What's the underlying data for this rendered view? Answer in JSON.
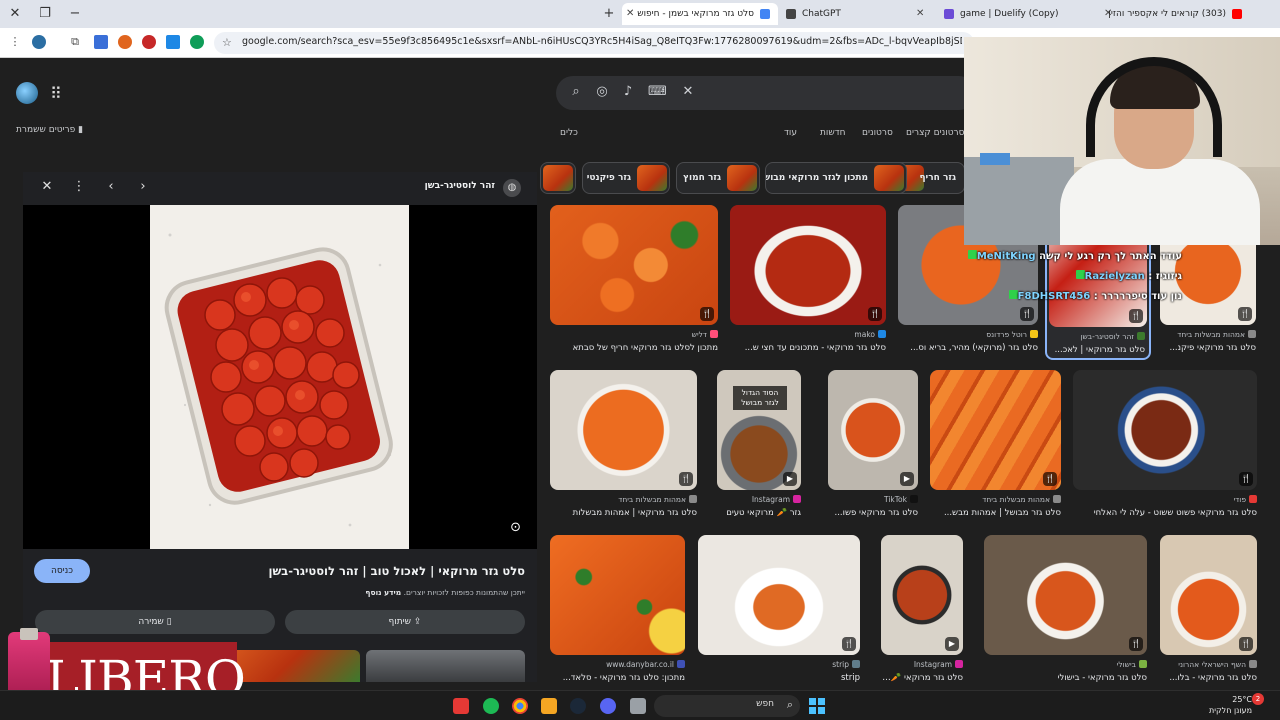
{
  "browser": {
    "tabs": [
      {
        "label": "סלט גזר מרוקאי בשמן - חיפוש",
        "active": true,
        "icon_color": "#4285f4"
      },
      {
        "label": "ChatGPT",
        "active": false,
        "icon_color": "#444444"
      },
      {
        "label": "game | Duelify (Copy)",
        "active": false,
        "icon_color": "#6b4bd6"
      },
      {
        "label": "(303) קוראים לי אקספיר והזין",
        "active": false,
        "icon_color": "#ff0000"
      }
    ],
    "new_tab": "+",
    "url": "google.com/search?sca_esv=55e9f3c856495c1e&sxsrf=ANbL-n6iHUsCQ3YRc5H4iSag_Q8eITQ3Fw:1776280097619&udm=2&fbs=ADc_l-bqvVeapIb8jSDlmbeWzvbR33r0bwiw_b"
  },
  "google": {
    "saved_label": "פריטים ששמרת",
    "search_value": "",
    "filters": [
      "סרטונים קצרים",
      "סרטונים",
      "חדשות",
      "עוד",
      "כלים"
    ],
    "chips": [
      {
        "label": "גזר חריף"
      },
      {
        "label": "מתכון לגזר מרוקאי מבושל"
      },
      {
        "label": "גזר חמוץ"
      },
      {
        "label": "גזר פיקנטי"
      }
    ]
  },
  "preview": {
    "source": "זהר לוסטיגר-בשן",
    "title": "סלט גזר מרוקאי | לאכול טוב | זהר לוסטיגר-בשן",
    "note_prefix": "ייתכן שהתמונות כפופות לזכויות יוצרים.",
    "note_link": "מידע נוסף",
    "visit_label": "כניסה",
    "share_label": "שיתוף",
    "save_label": "שמירה"
  },
  "results": [
    {
      "source": "דליש",
      "title": "מתכון לסלט גזר מרוקאי חריף של סבתא",
      "badge": "🍴",
      "src_color": "#ff4f7a"
    },
    {
      "source": "mako",
      "title": "סלט גזר מרוקאי - מתכונים עד חצי ש...",
      "badge": "🍴",
      "src_color": "#1e88e5"
    },
    {
      "source": "רוטל פרדונס",
      "title": "סלט גזר (מרוקאי) מהיר, בריא וס...",
      "badge": "🍴",
      "src_color": "#f5c518"
    },
    {
      "source": "זהר לוסטיגר-בשן",
      "title": "סלט גזר מרוקאי | לאכ...",
      "badge": "🍴",
      "src_color": "#3c7a2d"
    },
    {
      "source": "אמהות מבשלות ביחד",
      "title": "סלט גזר מרוקאי פיקנ...",
      "badge": "🍴",
      "src_color": "#8a8a8a"
    },
    {
      "source": "פודי",
      "title": "סלט גזר מרוקאי פשוט ששוט - עלה לי האלחי",
      "badge": "🍴",
      "src_color": "#e53935"
    },
    {
      "source": "אמהות מבשלות ביחד",
      "title": "סלט גזר מבושל | אמהות מבש...",
      "badge": "🍴",
      "src_color": "#8a8a8a"
    },
    {
      "source": "TikTok",
      "title": "סלט גזר מרוקאי פשו...",
      "badge": "▶",
      "src_color": "#111111"
    },
    {
      "source": "Instagram",
      "title": "גזר 🥕 מרוקאי טעים",
      "badge": "▶",
      "src_color": "#d6249f"
    },
    {
      "source": "אמהות מבשלות ביחד",
      "title": "סלט גזר מרוקאי | אמהות מבשלות",
      "badge": "🍴",
      "src_color": "#8a8a8a"
    },
    {
      "source": "השף הישראלי אהרוני",
      "title": "סלט גזר מרוקאי - בלו...",
      "badge": "🍴",
      "src_color": "#8a8a8a"
    },
    {
      "source": "בישולי",
      "title": "סלט גזר מרוקאי - בישולי",
      "badge": "🍴",
      "src_color": "#7cb342"
    },
    {
      "source": "Instagram",
      "title": "סלט גזר מרוקאי 🥕 מ...",
      "badge": "▶",
      "src_color": "#d6249f"
    },
    {
      "source": "strip",
      "title": "strip",
      "badge": "🍴",
      "src_color": "#607d8b"
    },
    {
      "source": "www.danybar.co.il",
      "title": "מתכון: סלט גזר מרוקאי - סלאד...",
      "badge": "",
      "src_color": "#3f51b5"
    }
  ],
  "overlay_text": "הסוד הגדול לגזר מבושל",
  "chat": {
    "lines": [
      {
        "nick": "MeNitKing",
        "text": "עודד האתר לך רק רגע לי קשה"
      },
      {
        "nick": "Razielyzan",
        "text": "גיזוגיז"
      },
      {
        "nick": "F8DHSRT456",
        "text": "נון עוד סיפררררר"
      }
    ]
  },
  "libero": {
    "text": "LIBERO",
    "bottle_label": "LIBERO"
  },
  "taskbar": {
    "search_label": "חפש",
    "weather_temp": "25°C",
    "weather_desc": "מעונן חלקית",
    "notif_count": "2"
  }
}
